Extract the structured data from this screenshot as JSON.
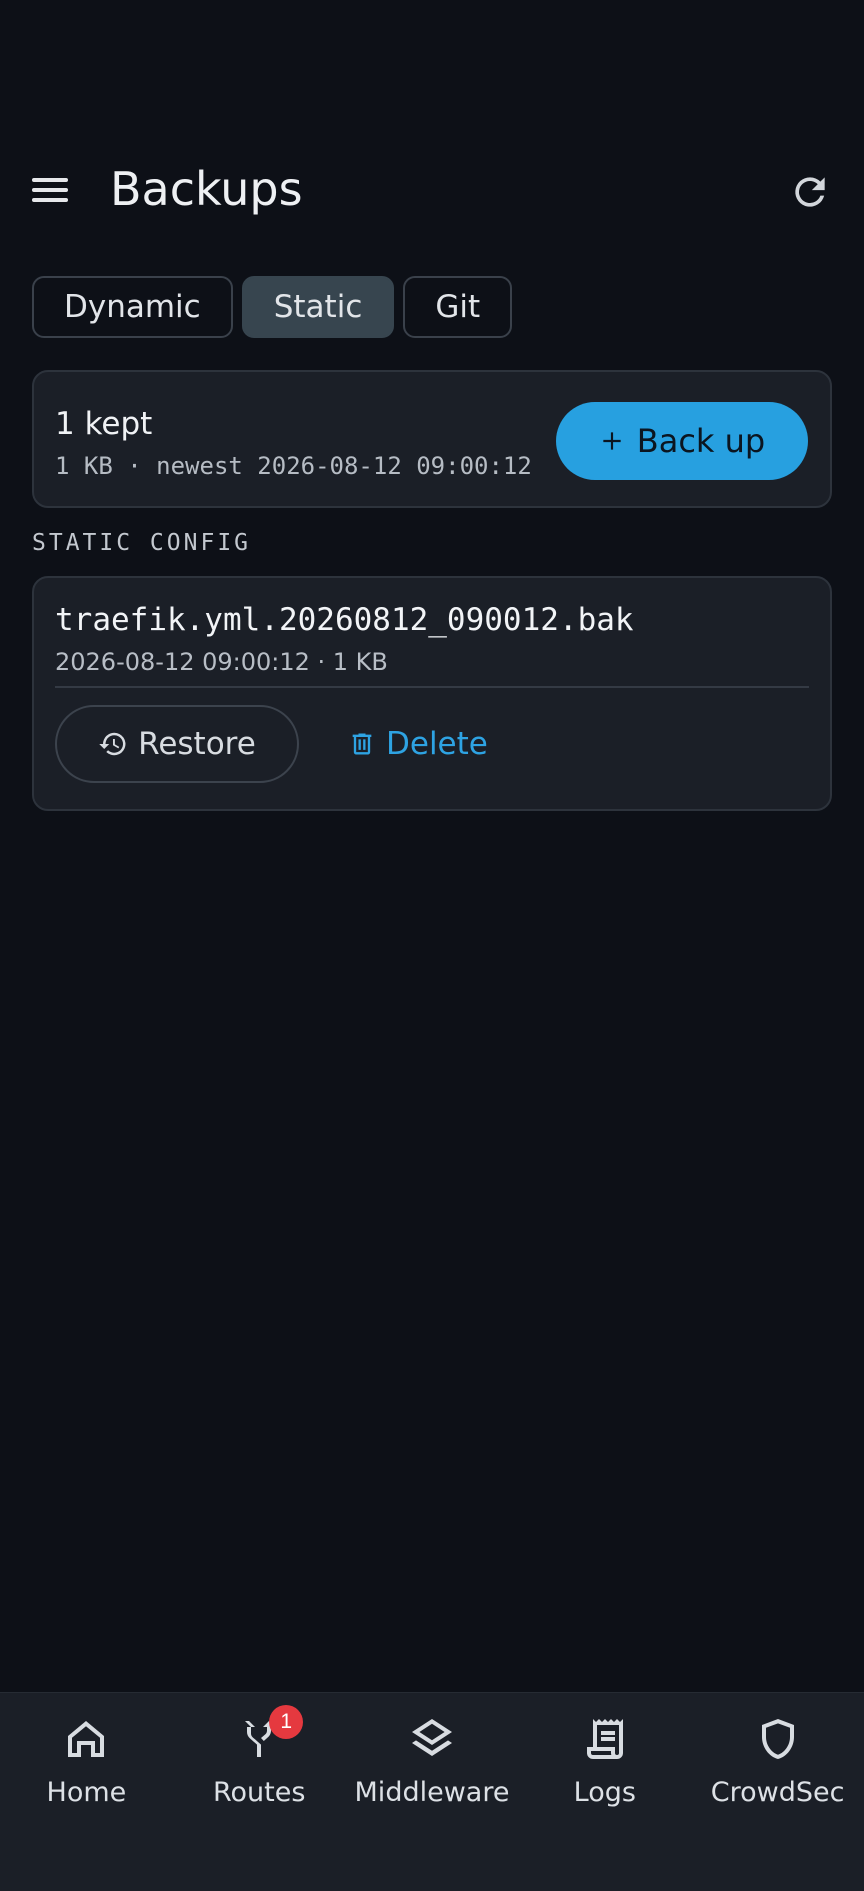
{
  "header": {
    "title": "Backups",
    "menu_icon": "hamburger-menu-icon",
    "refresh_icon": "refresh-icon"
  },
  "tabs": [
    {
      "label": "Dynamic",
      "active": false
    },
    {
      "label": "Static",
      "active": true
    },
    {
      "label": "Git",
      "active": false
    }
  ],
  "summary": {
    "kept": "1 kept",
    "meta": "1 KB · newest 2026-08-12 09:00:12",
    "backup_button": "Back up",
    "backup_icon": "plus-icon"
  },
  "section": {
    "label": "STATIC CONFIG"
  },
  "backups": [
    {
      "file_name": "traefik.yml.20260812_090012.bak",
      "meta": "2026-08-12 09:00:12 · 1 KB",
      "restore_label": "Restore",
      "delete_label": "Delete"
    }
  ],
  "nav": {
    "items": [
      {
        "label": "Home",
        "icon": "home-icon"
      },
      {
        "label": "Routes",
        "icon": "routes-icon",
        "badge": "1"
      },
      {
        "label": "Middleware",
        "icon": "layers-icon"
      },
      {
        "label": "Logs",
        "icon": "logs-icon"
      },
      {
        "label": "CrowdSec",
        "icon": "shield-icon"
      }
    ]
  },
  "colors": {
    "background": "#0d1017",
    "card": "#1b1f27",
    "accent": "#27a0e0",
    "badge": "#e5393f",
    "active_tab": "#37454f"
  }
}
